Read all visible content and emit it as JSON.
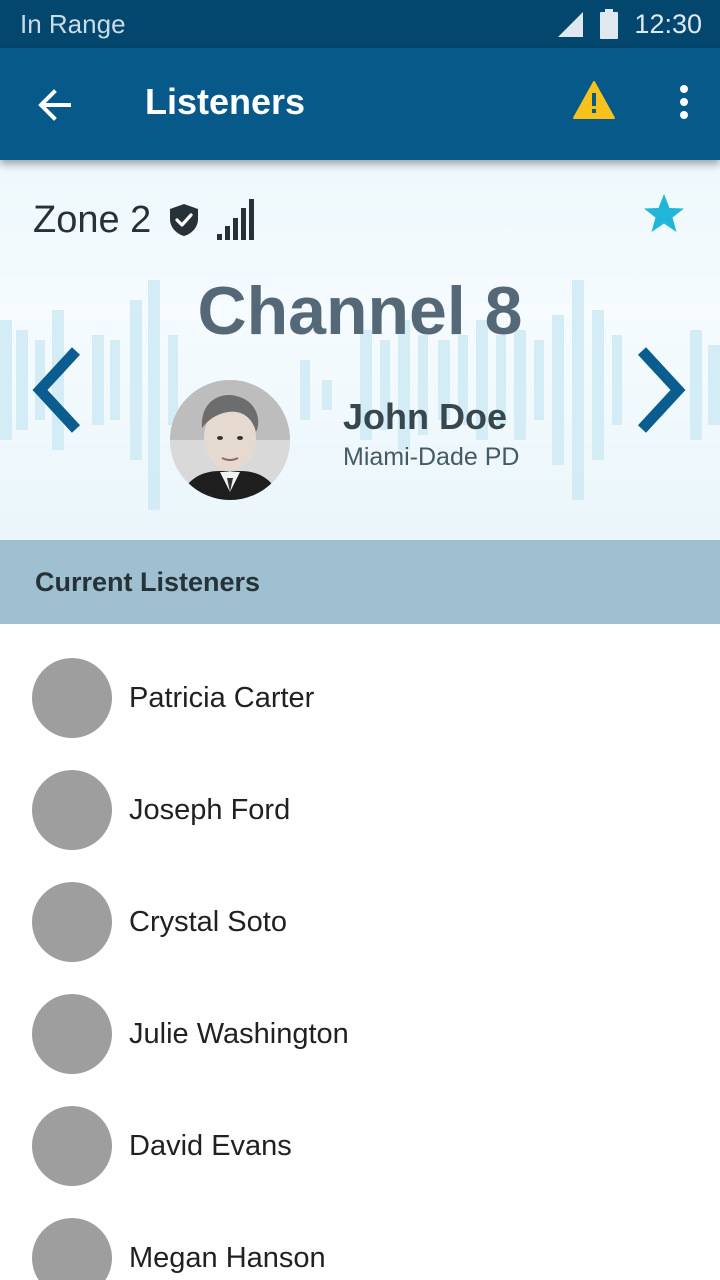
{
  "status_bar": {
    "carrier": "In Range",
    "time": "12:30"
  },
  "app_bar": {
    "title": "Listeners",
    "warning_color": "#f7c21b"
  },
  "channel": {
    "zone": "Zone 2",
    "name": "Channel 8",
    "favorite_color": "#1fb6d8",
    "arrow_color": "#0b5d8f",
    "speaker": {
      "name": "John Doe",
      "organization": "Miami-Dade PD"
    }
  },
  "section": {
    "title": "Current Listeners"
  },
  "listeners": [
    {
      "name": "Patricia Carter"
    },
    {
      "name": "Joseph Ford"
    },
    {
      "name": "Crystal Soto"
    },
    {
      "name": "Julie Washington"
    },
    {
      "name": "David Evans"
    },
    {
      "name": "Megan Hanson"
    }
  ],
  "icons": {
    "back": "arrow-left-icon",
    "warning": "warning-icon",
    "more": "more-vert-icon",
    "shield": "shield-check-icon",
    "signal": "signal-bars-icon",
    "star": "star-icon",
    "prev": "chevron-left-icon",
    "next": "chevron-right-icon"
  }
}
